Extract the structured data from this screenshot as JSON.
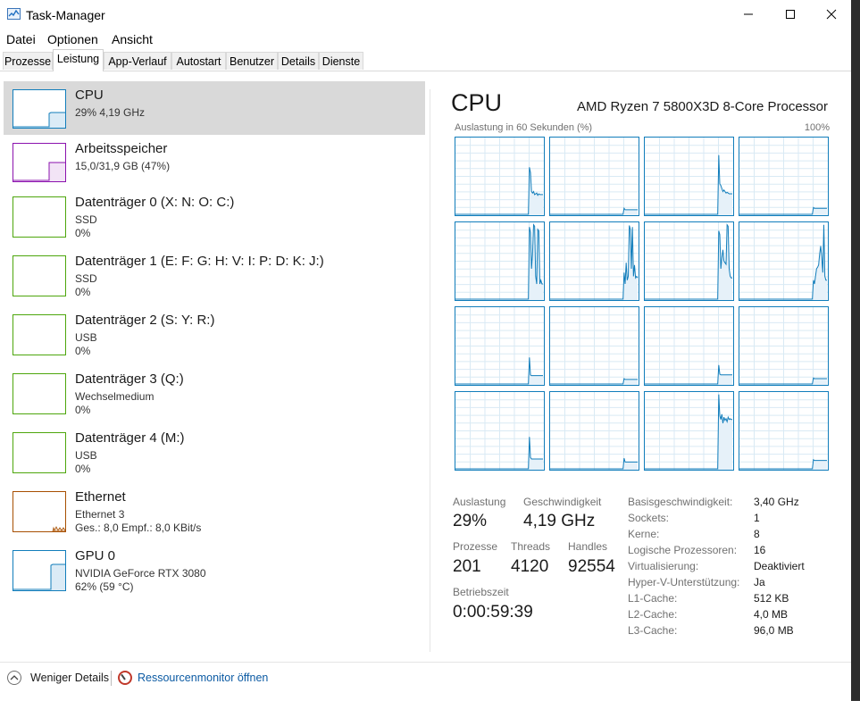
{
  "window": {
    "title": "Task-Manager",
    "minimize": "—",
    "maximize": "☐",
    "close": "✕"
  },
  "menu": [
    "Datei",
    "Optionen",
    "Ansicht"
  ],
  "tabs": [
    "Prozesse",
    "Leistung",
    "App-Verlauf",
    "Autostart",
    "Benutzer",
    "Details",
    "Dienste"
  ],
  "active_tab": "Leistung",
  "devices": [
    {
      "name": "CPU",
      "line1": "29%  4,19 GHz",
      "line2": "",
      "color": "#117dbb",
      "selected": true
    },
    {
      "name": "Arbeitsspeicher",
      "line1": "15,0/31,9 GB (47%)",
      "line2": "",
      "color": "#8b12ae"
    },
    {
      "name": "Datenträger 0 (X: N: O: C:)",
      "line1": "SSD",
      "line2": "0%",
      "color": "#4da60c"
    },
    {
      "name": "Datenträger 1 (E: F: G: H: V: I: P: D: K: J:)",
      "line1": "SSD",
      "line2": "0%",
      "color": "#4da60c"
    },
    {
      "name": "Datenträger 2 (S: Y: R:)",
      "line1": "USB",
      "line2": "0%",
      "color": "#4da60c"
    },
    {
      "name": "Datenträger 3 (Q:)",
      "line1": "Wechselmedium",
      "line2": "0%",
      "color": "#4da60c"
    },
    {
      "name": "Datenträger 4 (M:)",
      "line1": "USB",
      "line2": "0%",
      "color": "#4da60c"
    },
    {
      "name": "Ethernet",
      "line1": "Ethernet 3",
      "line2": "Ges.: 8,0  Empf.: 8,0 KBit/s",
      "color": "#a74f01"
    },
    {
      "name": "GPU 0",
      "line1": "NVIDIA GeForce RTX 3080",
      "line2": "62%  (59 °C)",
      "color": "#117dbb"
    }
  ],
  "cpu": {
    "title": "CPU",
    "model": "AMD Ryzen 7 5800X3D 8-Core Processor",
    "axis_label": "Auslastung in 60 Sekunden (%)",
    "axis_max": "100%",
    "stats": {
      "auslastung_label": "Auslastung",
      "auslastung": "29%",
      "geschwindigkeit_label": "Geschwindigkeit",
      "geschwindigkeit": "4,19 GHz",
      "prozesse_label": "Prozesse",
      "prozesse": "201",
      "threads_label": "Threads",
      "threads": "4120",
      "handles_label": "Handles",
      "handles": "92554",
      "betriebszeit_label": "Betriebszeit",
      "betriebszeit": "0:00:59:39"
    },
    "properties": [
      {
        "key": "Basisgeschwindigkeit:",
        "value": "3,40 GHz"
      },
      {
        "key": "Sockets:",
        "value": "1"
      },
      {
        "key": "Kerne:",
        "value": "8"
      },
      {
        "key": "Logische Prozessoren:",
        "value": "16"
      },
      {
        "key": "Virtualisierung:",
        "value": "Deaktiviert"
      },
      {
        "key": "Hyper-V-Unterstützung:",
        "value": "Ja"
      },
      {
        "key": "L1-Cache:",
        "value": "512 KB"
      },
      {
        "key": "L2-Cache:",
        "value": "4,0 MB"
      },
      {
        "key": "L3-Cache:",
        "value": "96,0 MB"
      }
    ],
    "core_usage": [
      [
        0,
        0,
        0,
        0,
        0,
        0,
        0,
        0,
        0,
        0,
        0,
        0,
        0,
        0,
        0,
        0,
        0,
        0,
        0,
        0,
        0,
        0,
        0,
        0,
        0,
        0,
        0,
        0,
        0,
        0,
        0,
        0,
        0,
        0,
        0,
        0,
        0,
        0,
        0,
        0,
        0,
        0,
        0,
        0,
        0,
        0,
        0,
        0,
        0,
        0,
        0,
        0,
        0,
        0,
        0,
        0,
        0,
        0,
        0,
        0,
        0,
        0,
        0,
        0,
        0,
        0,
        0,
        0,
        0,
        0,
        0,
        62,
        55,
        30,
        28,
        30,
        26,
        27,
        28,
        25,
        27,
        26,
        26,
        26,
        26
      ],
      [
        0,
        0,
        0,
        0,
        0,
        0,
        0,
        0,
        0,
        0,
        0,
        0,
        0,
        0,
        0,
        0,
        0,
        0,
        0,
        0,
        0,
        0,
        0,
        0,
        0,
        0,
        0,
        0,
        0,
        0,
        0,
        0,
        0,
        0,
        0,
        0,
        0,
        0,
        0,
        0,
        0,
        0,
        0,
        0,
        0,
        0,
        0,
        0,
        0,
        0,
        0,
        0,
        0,
        0,
        0,
        0,
        0,
        0,
        0,
        0,
        0,
        0,
        0,
        0,
        0,
        0,
        0,
        0,
        0,
        0,
        0,
        8,
        6,
        6,
        6,
        6,
        6,
        6,
        6,
        6,
        6,
        6,
        6,
        6,
        6
      ],
      [
        0,
        0,
        0,
        0,
        0,
        0,
        0,
        0,
        0,
        0,
        0,
        0,
        0,
        0,
        0,
        0,
        0,
        0,
        0,
        0,
        0,
        0,
        0,
        0,
        0,
        0,
        0,
        0,
        0,
        0,
        0,
        0,
        0,
        0,
        0,
        0,
        0,
        0,
        0,
        0,
        0,
        0,
        0,
        0,
        0,
        0,
        0,
        0,
        0,
        0,
        0,
        0,
        0,
        0,
        0,
        0,
        0,
        0,
        0,
        0,
        0,
        0,
        0,
        0,
        0,
        0,
        0,
        0,
        0,
        0,
        0,
        78,
        40,
        38,
        34,
        30,
        32,
        30,
        28,
        29,
        28,
        27,
        27,
        27,
        27
      ],
      [
        0,
        0,
        0,
        0,
        0,
        0,
        0,
        0,
        0,
        0,
        0,
        0,
        0,
        0,
        0,
        0,
        0,
        0,
        0,
        0,
        0,
        0,
        0,
        0,
        0,
        0,
        0,
        0,
        0,
        0,
        0,
        0,
        0,
        0,
        0,
        0,
        0,
        0,
        0,
        0,
        0,
        0,
        0,
        0,
        0,
        0,
        0,
        0,
        0,
        0,
        0,
        0,
        0,
        0,
        0,
        0,
        0,
        0,
        0,
        0,
        0,
        0,
        0,
        0,
        0,
        0,
        0,
        0,
        0,
        0,
        0,
        9,
        8,
        8,
        8,
        8,
        8,
        8,
        8,
        8,
        8,
        8,
        8,
        8,
        8
      ],
      [
        0,
        0,
        0,
        0,
        0,
        0,
        0,
        0,
        0,
        0,
        0,
        0,
        0,
        0,
        0,
        0,
        0,
        0,
        0,
        0,
        0,
        0,
        0,
        0,
        0,
        0,
        0,
        0,
        0,
        0,
        0,
        0,
        0,
        0,
        0,
        0,
        0,
        0,
        0,
        0,
        0,
        0,
        0,
        0,
        0,
        0,
        0,
        0,
        0,
        0,
        0,
        0,
        0,
        0,
        0,
        0,
        0,
        0,
        0,
        0,
        0,
        0,
        0,
        0,
        0,
        0,
        0,
        0,
        0,
        0,
        0,
        95,
        88,
        40,
        60,
        98,
        96,
        30,
        20,
        92,
        90,
        20,
        25,
        20,
        20
      ],
      [
        0,
        0,
        0,
        0,
        0,
        0,
        0,
        0,
        0,
        0,
        0,
        0,
        0,
        0,
        0,
        0,
        0,
        0,
        0,
        0,
        0,
        0,
        0,
        0,
        0,
        0,
        0,
        0,
        0,
        0,
        0,
        0,
        0,
        0,
        0,
        0,
        0,
        0,
        0,
        0,
        0,
        0,
        0,
        0,
        0,
        0,
        0,
        0,
        0,
        0,
        0,
        0,
        0,
        0,
        0,
        0,
        0,
        0,
        0,
        0,
        0,
        0,
        0,
        0,
        0,
        0,
        0,
        0,
        0,
        0,
        0,
        35,
        20,
        48,
        25,
        30,
        97,
        92,
        40,
        95,
        30,
        45,
        28,
        30,
        28
      ],
      [
        0,
        0,
        0,
        0,
        0,
        0,
        0,
        0,
        0,
        0,
        0,
        0,
        0,
        0,
        0,
        0,
        0,
        0,
        0,
        0,
        0,
        0,
        0,
        0,
        0,
        0,
        0,
        0,
        0,
        0,
        0,
        0,
        0,
        0,
        0,
        0,
        0,
        0,
        0,
        0,
        0,
        0,
        0,
        0,
        0,
        0,
        0,
        0,
        0,
        0,
        0,
        0,
        0,
        0,
        0,
        0,
        0,
        0,
        0,
        0,
        0,
        0,
        0,
        0,
        0,
        0,
        0,
        0,
        0,
        0,
        0,
        90,
        85,
        40,
        55,
        65,
        50,
        48,
        46,
        98,
        96,
        40,
        30,
        28,
        28
      ],
      [
        0,
        0,
        0,
        0,
        0,
        0,
        0,
        0,
        0,
        0,
        0,
        0,
        0,
        0,
        0,
        0,
        0,
        0,
        0,
        0,
        0,
        0,
        0,
        0,
        0,
        0,
        0,
        0,
        0,
        0,
        0,
        0,
        0,
        0,
        0,
        0,
        0,
        0,
        0,
        0,
        0,
        0,
        0,
        0,
        0,
        0,
        0,
        0,
        0,
        0,
        0,
        0,
        0,
        0,
        0,
        0,
        0,
        0,
        0,
        0,
        0,
        0,
        0,
        0,
        0,
        0,
        0,
        0,
        0,
        0,
        0,
        25,
        20,
        30,
        40,
        42,
        45,
        60,
        70,
        55,
        35,
        98,
        30,
        25,
        25
      ],
      [
        0,
        0,
        0,
        0,
        0,
        0,
        0,
        0,
        0,
        0,
        0,
        0,
        0,
        0,
        0,
        0,
        0,
        0,
        0,
        0,
        0,
        0,
        0,
        0,
        0,
        0,
        0,
        0,
        0,
        0,
        0,
        0,
        0,
        0,
        0,
        0,
        0,
        0,
        0,
        0,
        0,
        0,
        0,
        0,
        0,
        0,
        0,
        0,
        0,
        0,
        0,
        0,
        0,
        0,
        0,
        0,
        0,
        0,
        0,
        0,
        0,
        0,
        0,
        0,
        0,
        0,
        0,
        0,
        0,
        0,
        0,
        35,
        12,
        11,
        11,
        11,
        11,
        11,
        11,
        11,
        11,
        11,
        11,
        11,
        11
      ],
      [
        0,
        0,
        0,
        0,
        0,
        0,
        0,
        0,
        0,
        0,
        0,
        0,
        0,
        0,
        0,
        0,
        0,
        0,
        0,
        0,
        0,
        0,
        0,
        0,
        0,
        0,
        0,
        0,
        0,
        0,
        0,
        0,
        0,
        0,
        0,
        0,
        0,
        0,
        0,
        0,
        0,
        0,
        0,
        0,
        0,
        0,
        0,
        0,
        0,
        0,
        0,
        0,
        0,
        0,
        0,
        0,
        0,
        0,
        0,
        0,
        0,
        0,
        0,
        0,
        0,
        0,
        0,
        0,
        0,
        0,
        0,
        7,
        6,
        6,
        6,
        6,
        6,
        6,
        6,
        6,
        6,
        6,
        6,
        6,
        6
      ],
      [
        0,
        0,
        0,
        0,
        0,
        0,
        0,
        0,
        0,
        0,
        0,
        0,
        0,
        0,
        0,
        0,
        0,
        0,
        0,
        0,
        0,
        0,
        0,
        0,
        0,
        0,
        0,
        0,
        0,
        0,
        0,
        0,
        0,
        0,
        0,
        0,
        0,
        0,
        0,
        0,
        0,
        0,
        0,
        0,
        0,
        0,
        0,
        0,
        0,
        0,
        0,
        0,
        0,
        0,
        0,
        0,
        0,
        0,
        0,
        0,
        0,
        0,
        0,
        0,
        0,
        0,
        0,
        0,
        0,
        0,
        0,
        25,
        13,
        12,
        12,
        12,
        12,
        12,
        12,
        12,
        12,
        12,
        12,
        12,
        12
      ],
      [
        0,
        0,
        0,
        0,
        0,
        0,
        0,
        0,
        0,
        0,
        0,
        0,
        0,
        0,
        0,
        0,
        0,
        0,
        0,
        0,
        0,
        0,
        0,
        0,
        0,
        0,
        0,
        0,
        0,
        0,
        0,
        0,
        0,
        0,
        0,
        0,
        0,
        0,
        0,
        0,
        0,
        0,
        0,
        0,
        0,
        0,
        0,
        0,
        0,
        0,
        0,
        0,
        0,
        0,
        0,
        0,
        0,
        0,
        0,
        0,
        0,
        0,
        0,
        0,
        0,
        0,
        0,
        0,
        0,
        0,
        0,
        8,
        7,
        7,
        7,
        7,
        7,
        7,
        7,
        7,
        7,
        7,
        7,
        7,
        7
      ],
      [
        0,
        0,
        0,
        0,
        0,
        0,
        0,
        0,
        0,
        0,
        0,
        0,
        0,
        0,
        0,
        0,
        0,
        0,
        0,
        0,
        0,
        0,
        0,
        0,
        0,
        0,
        0,
        0,
        0,
        0,
        0,
        0,
        0,
        0,
        0,
        0,
        0,
        0,
        0,
        0,
        0,
        0,
        0,
        0,
        0,
        0,
        0,
        0,
        0,
        0,
        0,
        0,
        0,
        0,
        0,
        0,
        0,
        0,
        0,
        0,
        0,
        0,
        0,
        0,
        0,
        0,
        0,
        0,
        0,
        0,
        0,
        42,
        15,
        13,
        13,
        13,
        13,
        13,
        13,
        13,
        13,
        13,
        13,
        13,
        13
      ],
      [
        0,
        0,
        0,
        0,
        0,
        0,
        0,
        0,
        0,
        0,
        0,
        0,
        0,
        0,
        0,
        0,
        0,
        0,
        0,
        0,
        0,
        0,
        0,
        0,
        0,
        0,
        0,
        0,
        0,
        0,
        0,
        0,
        0,
        0,
        0,
        0,
        0,
        0,
        0,
        0,
        0,
        0,
        0,
        0,
        0,
        0,
        0,
        0,
        0,
        0,
        0,
        0,
        0,
        0,
        0,
        0,
        0,
        0,
        0,
        0,
        0,
        0,
        0,
        0,
        0,
        0,
        0,
        0,
        0,
        0,
        0,
        14,
        9,
        9,
        9,
        9,
        9,
        9,
        9,
        9,
        9,
        9,
        9,
        9,
        9
      ],
      [
        0,
        0,
        0,
        0,
        0,
        0,
        0,
        0,
        0,
        0,
        0,
        0,
        0,
        0,
        0,
        0,
        0,
        0,
        0,
        0,
        0,
        0,
        0,
        0,
        0,
        0,
        0,
        0,
        0,
        0,
        0,
        0,
        0,
        0,
        0,
        0,
        0,
        0,
        0,
        0,
        0,
        0,
        0,
        0,
        0,
        0,
        0,
        0,
        0,
        0,
        0,
        0,
        0,
        0,
        0,
        0,
        0,
        0,
        0,
        0,
        0,
        0,
        0,
        0,
        0,
        0,
        0,
        0,
        0,
        0,
        0,
        98,
        70,
        65,
        72,
        60,
        68,
        64,
        66,
        62,
        68,
        65,
        66,
        65,
        65
      ],
      [
        0,
        0,
        0,
        0,
        0,
        0,
        0,
        0,
        0,
        0,
        0,
        0,
        0,
        0,
        0,
        0,
        0,
        0,
        0,
        0,
        0,
        0,
        0,
        0,
        0,
        0,
        0,
        0,
        0,
        0,
        0,
        0,
        0,
        0,
        0,
        0,
        0,
        0,
        0,
        0,
        0,
        0,
        0,
        0,
        0,
        0,
        0,
        0,
        0,
        0,
        0,
        0,
        0,
        0,
        0,
        0,
        0,
        0,
        0,
        0,
        0,
        0,
        0,
        0,
        0,
        0,
        0,
        0,
        0,
        0,
        0,
        12,
        11,
        11,
        11,
        11,
        11,
        11,
        11,
        11,
        11,
        11,
        11,
        11,
        11
      ]
    ]
  },
  "footer": {
    "fewer_details": "Weniger Details",
    "resource_monitor": "Ressourcenmonitor öffnen"
  }
}
